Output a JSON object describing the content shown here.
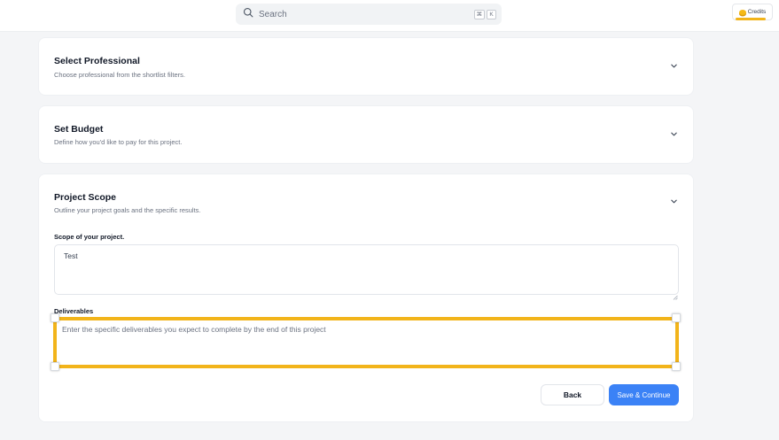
{
  "header": {
    "search_placeholder": "Search",
    "shortcut_keys": [
      "⌘",
      "K"
    ],
    "credits_label": "Credits"
  },
  "sections": [
    {
      "title": "Select Professional",
      "subtitle": "Choose professional from the shortlist filters.",
      "expanded": false
    },
    {
      "title": "Set Budget",
      "subtitle": "Define how you'd like to pay for this project.",
      "expanded": false
    },
    {
      "title": "Project Scope",
      "subtitle": "Outline your project goals and the specific results.",
      "expanded": true
    }
  ],
  "scope_form": {
    "scope_label": "Scope of your project.",
    "scope_value": "Test",
    "deliverables_label": "Deliverables",
    "deliverables_placeholder": "Enter the specific deliverables you expect to complete by the end of this project"
  },
  "actions": {
    "back_label": "Back",
    "save_label": "Save & Continue"
  },
  "colors": {
    "accent": "#3b82f6",
    "highlight": "#f2b41a",
    "background": "#f4f5f7"
  }
}
